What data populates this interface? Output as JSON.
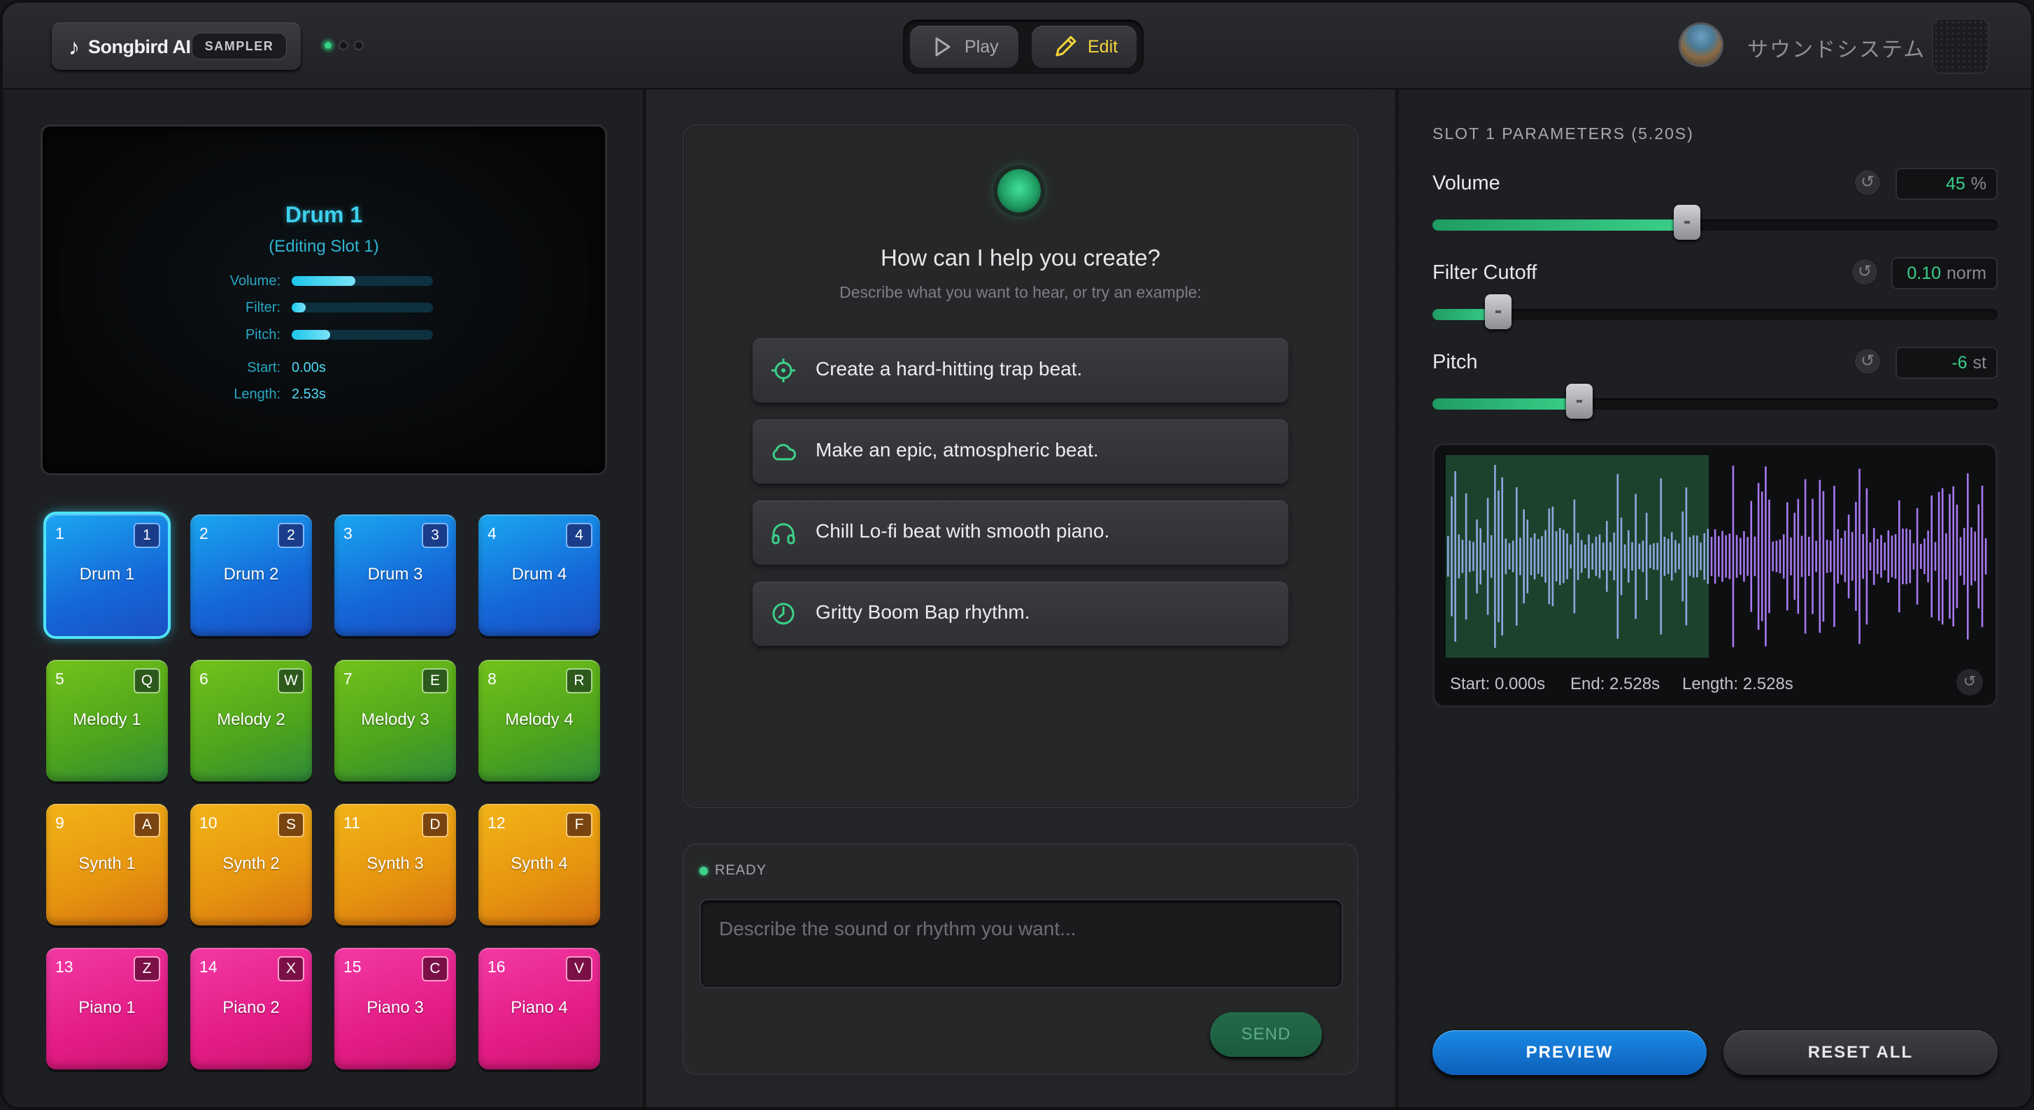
{
  "header": {
    "logo_name": "Songbird AI",
    "logo_badge": "SAMPLER",
    "mode_play": "Play",
    "mode_edit": "Edit",
    "mode_active": "Edit",
    "system_title": "サウンドシステム"
  },
  "lcd": {
    "title": "Drum 1",
    "subtitle": "(Editing Slot 1)",
    "volume_label": "Volume:",
    "volume_level": 0.45,
    "filter_label": "Filter:",
    "filter_level": 0.1,
    "pitch_label": "Pitch:",
    "pitch_level": 0.27,
    "start_label": "Start:",
    "start_value": "0.00s",
    "length_label": "Length:",
    "length_value": "2.53s"
  },
  "pads": [
    {
      "num": "1",
      "key": "1",
      "name": "Drum 1",
      "color": "blue",
      "selected": true
    },
    {
      "num": "2",
      "key": "2",
      "name": "Drum 2",
      "color": "blue"
    },
    {
      "num": "3",
      "key": "3",
      "name": "Drum 3",
      "color": "blue"
    },
    {
      "num": "4",
      "key": "4",
      "name": "Drum 4",
      "color": "blue"
    },
    {
      "num": "5",
      "key": "Q",
      "name": "Melody 1",
      "color": "green"
    },
    {
      "num": "6",
      "key": "W",
      "name": "Melody 2",
      "color": "green"
    },
    {
      "num": "7",
      "key": "E",
      "name": "Melody 3",
      "color": "green"
    },
    {
      "num": "8",
      "key": "R",
      "name": "Melody 4",
      "color": "green"
    },
    {
      "num": "9",
      "key": "A",
      "name": "Synth 1",
      "color": "orange"
    },
    {
      "num": "10",
      "key": "S",
      "name": "Synth 2",
      "color": "orange"
    },
    {
      "num": "11",
      "key": "D",
      "name": "Synth 3",
      "color": "orange"
    },
    {
      "num": "12",
      "key": "F",
      "name": "Synth 4",
      "color": "orange"
    },
    {
      "num": "13",
      "key": "Z",
      "name": "Piano 1",
      "color": "pink"
    },
    {
      "num": "14",
      "key": "X",
      "name": "Piano 2",
      "color": "pink"
    },
    {
      "num": "15",
      "key": "C",
      "name": "Piano 3",
      "color": "pink"
    },
    {
      "num": "16",
      "key": "V",
      "name": "Piano 4",
      "color": "pink"
    }
  ],
  "chat": {
    "title": "How can I help you create?",
    "subtitle": "Describe what you want to hear, or try an example:",
    "suggestions": [
      {
        "text": "Create a hard-hitting trap beat.",
        "icon": "crosshair-icon"
      },
      {
        "text": "Make an epic, atmospheric beat.",
        "icon": "cloud-icon"
      },
      {
        "text": "Chill Lo-fi beat with smooth piano.",
        "icon": "headphones-icon"
      },
      {
        "text": "Gritty Boom Bap rhythm.",
        "icon": "clock-icon"
      }
    ],
    "status": "READY",
    "input_value": "",
    "input_placeholder": "Describe the sound or rhythm you want...",
    "send_label": "SEND"
  },
  "params": {
    "title": "SLOT 1 PARAMETERS (5.20S)",
    "volume": {
      "label": "Volume",
      "value": "45",
      "unit": "%",
      "level": 0.45
    },
    "filter": {
      "label": "Filter Cutoff",
      "value": "0.10",
      "unit": "norm",
      "level": 0.116
    },
    "pitch": {
      "label": "Pitch",
      "value": "-6",
      "unit": "st",
      "level": 0.26
    },
    "waveform": {
      "start": "Start: 0.000s",
      "end": "End: 2.528s",
      "length": "Length: 2.528s",
      "selection_fraction": 0.486
    },
    "preview_label": "PREVIEW",
    "reset_all_label": "RESET ALL"
  },
  "colors": {
    "accent_green": "#3bd18a",
    "lcd_cyan": "#3fd0ee",
    "preview_blue": "#1a8ae6",
    "edit_yellow": "#f5d53a",
    "waveform_purple": "#a678f0",
    "waveform_selected": "#8fa7e0"
  }
}
